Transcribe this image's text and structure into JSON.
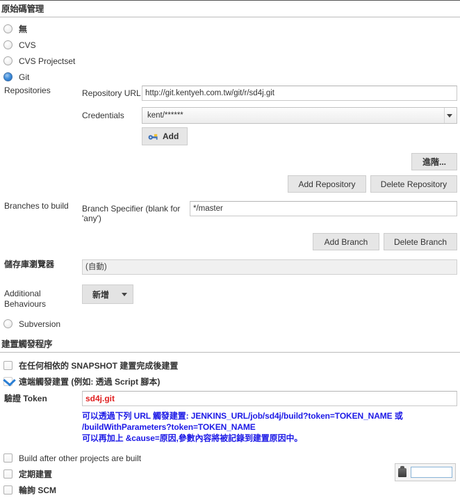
{
  "scm_section": {
    "header": "原始碼管理",
    "options": [
      {
        "label": "無",
        "selected": false
      },
      {
        "label": "CVS",
        "selected": false
      },
      {
        "label": "CVS Projectset",
        "selected": false
      },
      {
        "label": "Git",
        "selected": true
      }
    ],
    "subversion_label": "Subversion",
    "repositories_label": "Repositories",
    "repository_url_label": "Repository URL",
    "repository_url_value": "http://git.kentyeh.com.tw/git/r/sd4j.git",
    "credentials_label": "Credentials",
    "credentials_value": "kent/******",
    "add_credentials_label": "Add",
    "advanced_label": "進階...",
    "add_repository_label": "Add Repository",
    "delete_repository_label": "Delete Repository",
    "branches_label": "Branches to build",
    "branch_specifier_label": "Branch Specifier (blank for 'any')",
    "branch_specifier_value": "*/master",
    "add_branch_label": "Add Branch",
    "delete_branch_label": "Delete Branch",
    "repo_browser_label": "儲存庫瀏覽器",
    "repo_browser_value": "(自動)",
    "additional_behaviours_label": "Additional Behaviours",
    "additional_behaviours_button": "新增"
  },
  "triggers_section": {
    "header": "建置觸發程序",
    "items": [
      {
        "label": "在任何相依的 SNAPSHOT 建置完成後建置",
        "checked": false
      },
      {
        "label": "遠端觸發建置 (例如: 透過 Script 腳本)",
        "checked": true
      }
    ],
    "token_label": "驗證 Token",
    "token_value": "sd4j.git",
    "notice_line1": "可以透過下列 URL 觸發建置: JENKINS_URL/job/sd4j/build?token=TOKEN_NAME 或",
    "notice_line2": "/buildWithParameters?token=TOKEN_NAME",
    "notice_line3": "可以再加上 &cause=原因,參數內容將被記錄到建置原因中。",
    "trailing_items": [
      {
        "label": "Build after other projects are built",
        "checked": false
      },
      {
        "label": "定期建置",
        "checked": false
      },
      {
        "label": "輪詢 SCM",
        "checked": false
      }
    ]
  },
  "colors": {
    "notice_blue": "#1c19e6",
    "token_red": "#e02020",
    "radio_selected": "#3f8ddb",
    "checkbox_check": "#2b7fd4"
  }
}
